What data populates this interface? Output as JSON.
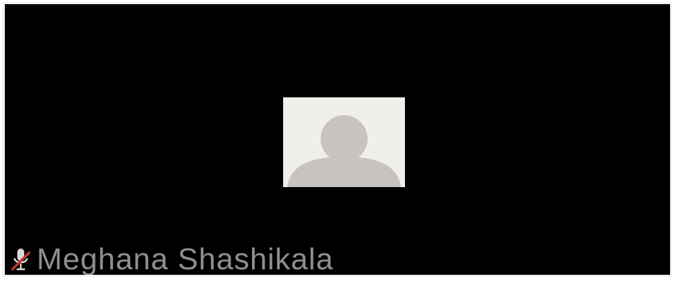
{
  "participant": {
    "name": "Meghana Shashikala",
    "mic_icon": "mic-muted-icon",
    "avatar_icon": "default-avatar-icon"
  },
  "colors": {
    "tile_background": "#000000",
    "tile_border": "#f2f2f2",
    "avatar_background": "#f1efeb",
    "avatar_silhouette": "#c7c3bf",
    "name_text": "#8f8f8f",
    "mute_slash": "#c0392b"
  }
}
